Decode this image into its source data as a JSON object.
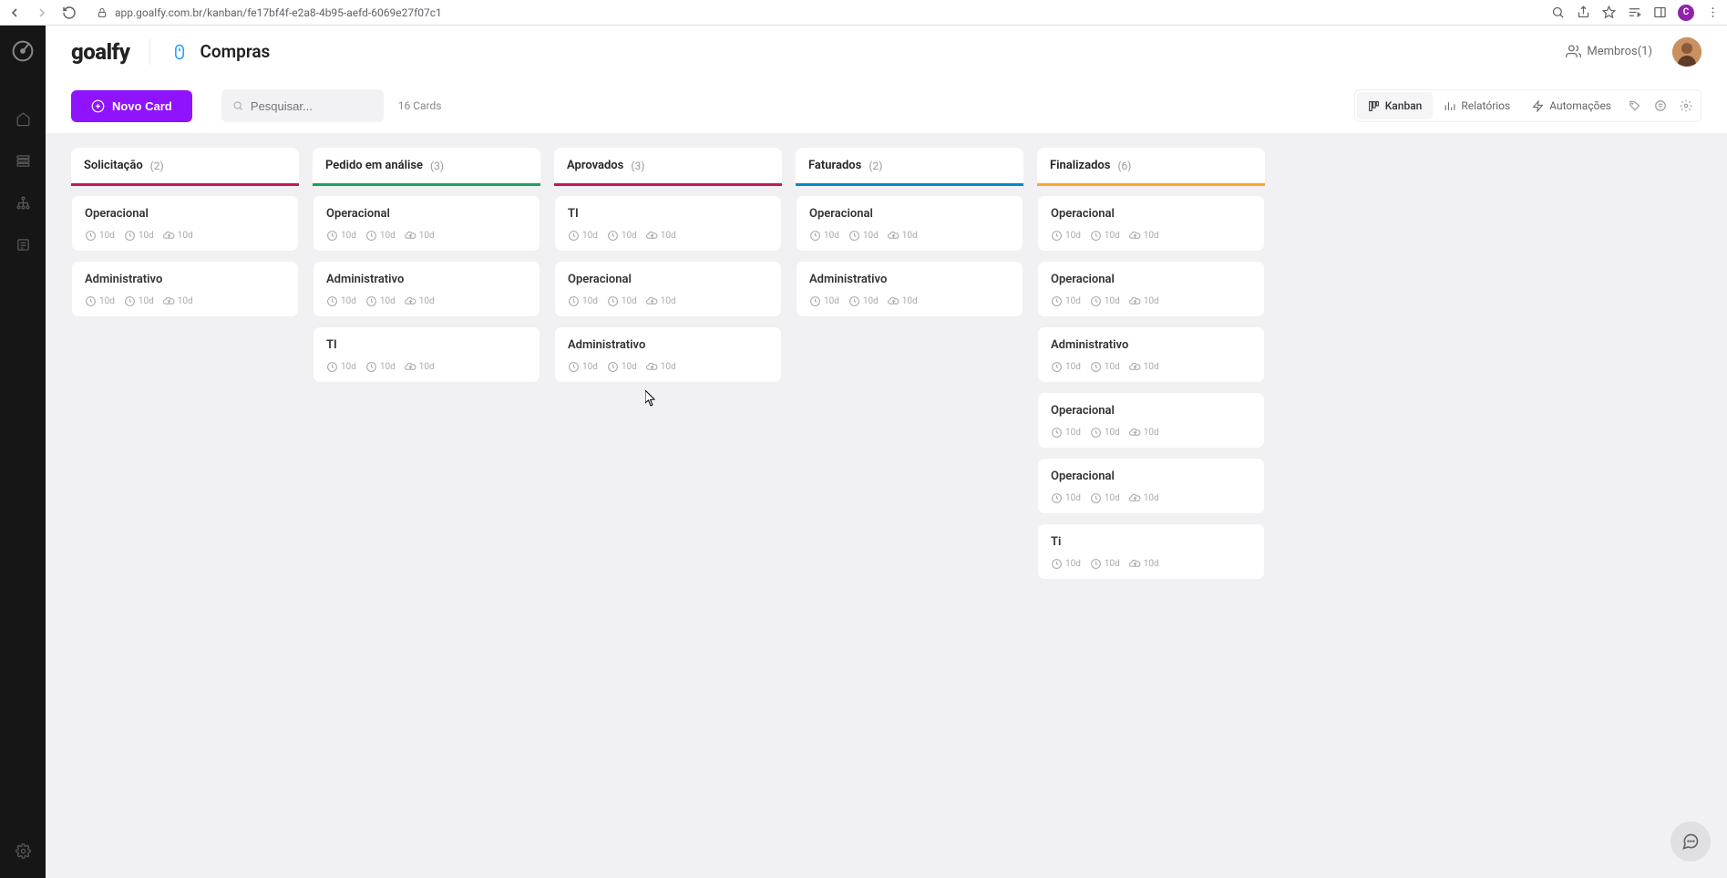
{
  "browser": {
    "url": "app.goalfy.com.br/kanban/fe17bf4f-e2a8-4b95-aefd-6069e27f07c1",
    "profile_initial": "C"
  },
  "header": {
    "brand": "goalfy",
    "page_title": "Compras",
    "members_label": "Membros(1)"
  },
  "toolbar": {
    "new_card_label": "Novo Card",
    "search_placeholder": "Pesquisar...",
    "card_count": "16 Cards",
    "view_kanban": "Kanban",
    "view_reports": "Relatórios",
    "view_automations": "Automações"
  },
  "columns": [
    {
      "title": "Solicitação",
      "count": "(2)",
      "color": "#c2185b",
      "cards": [
        {
          "title": "Operacional",
          "meta": [
            "10d",
            "10d",
            "10d"
          ],
          "icons": [
            "clock",
            "clock",
            "upload"
          ]
        },
        {
          "title": "Administrativo",
          "meta": [
            "10d",
            "10d",
            "10d"
          ],
          "icons": [
            "clock",
            "clock",
            "upload"
          ]
        }
      ]
    },
    {
      "title": "Pedido em análise",
      "count": "(3)",
      "color": "#1aa260",
      "cards": [
        {
          "title": "Operacional",
          "meta": [
            "10d",
            "10d",
            "10d"
          ],
          "icons": [
            "clock",
            "clock",
            "upload"
          ]
        },
        {
          "title": "Administrativo",
          "meta": [
            "10d",
            "10d",
            "10d"
          ],
          "icons": [
            "clock",
            "clock",
            "upload"
          ]
        },
        {
          "title": "TI",
          "meta": [
            "10d",
            "10d",
            "10d"
          ],
          "icons": [
            "clock",
            "clock",
            "upload"
          ]
        }
      ]
    },
    {
      "title": "Aprovados",
      "count": "(3)",
      "color": "#c2185b",
      "cards": [
        {
          "title": "TI",
          "meta": [
            "10d",
            "10d",
            "10d"
          ],
          "icons": [
            "clock",
            "clock",
            "upload"
          ]
        },
        {
          "title": "Operacional",
          "meta": [
            "10d",
            "10d",
            "10d"
          ],
          "icons": [
            "clock",
            "clock",
            "upload"
          ]
        },
        {
          "title": "Administrativo",
          "meta": [
            "10d",
            "10d",
            "10d"
          ],
          "icons": [
            "clock",
            "clock",
            "upload"
          ]
        }
      ]
    },
    {
      "title": "Faturados",
      "count": "(2)",
      "color": "#0288d1",
      "cards": [
        {
          "title": "Operacional",
          "meta": [
            "10d",
            "10d",
            "10d"
          ],
          "icons": [
            "clock",
            "clock",
            "upload"
          ]
        },
        {
          "title": "Administrativo",
          "meta": [
            "10d",
            "10d",
            "10d"
          ],
          "icons": [
            "clock",
            "clock",
            "upload"
          ]
        }
      ]
    },
    {
      "title": "Finalizados",
      "count": "(6)",
      "color": "#f9a825",
      "cards": [
        {
          "title": "Operacional",
          "meta": [
            "10d",
            "10d",
            "10d"
          ],
          "icons": [
            "clock",
            "clock",
            "upload"
          ]
        },
        {
          "title": "Operacional",
          "meta": [
            "10d",
            "10d",
            "10d"
          ],
          "icons": [
            "clock",
            "clock",
            "upload"
          ]
        },
        {
          "title": "Administrativo",
          "meta": [
            "10d",
            "10d",
            "10d"
          ],
          "icons": [
            "clock",
            "clock",
            "upload"
          ]
        },
        {
          "title": "Operacional",
          "meta": [
            "10d",
            "10d",
            "10d"
          ],
          "icons": [
            "clock",
            "clock",
            "upload"
          ]
        },
        {
          "title": "Operacional",
          "meta": [
            "10d",
            "10d",
            "10d"
          ],
          "icons": [
            "clock",
            "clock",
            "upload"
          ]
        },
        {
          "title": "Ti",
          "meta": [
            "10d",
            "10d",
            "10d"
          ],
          "icons": [
            "clock",
            "clock",
            "upload"
          ]
        }
      ]
    }
  ]
}
